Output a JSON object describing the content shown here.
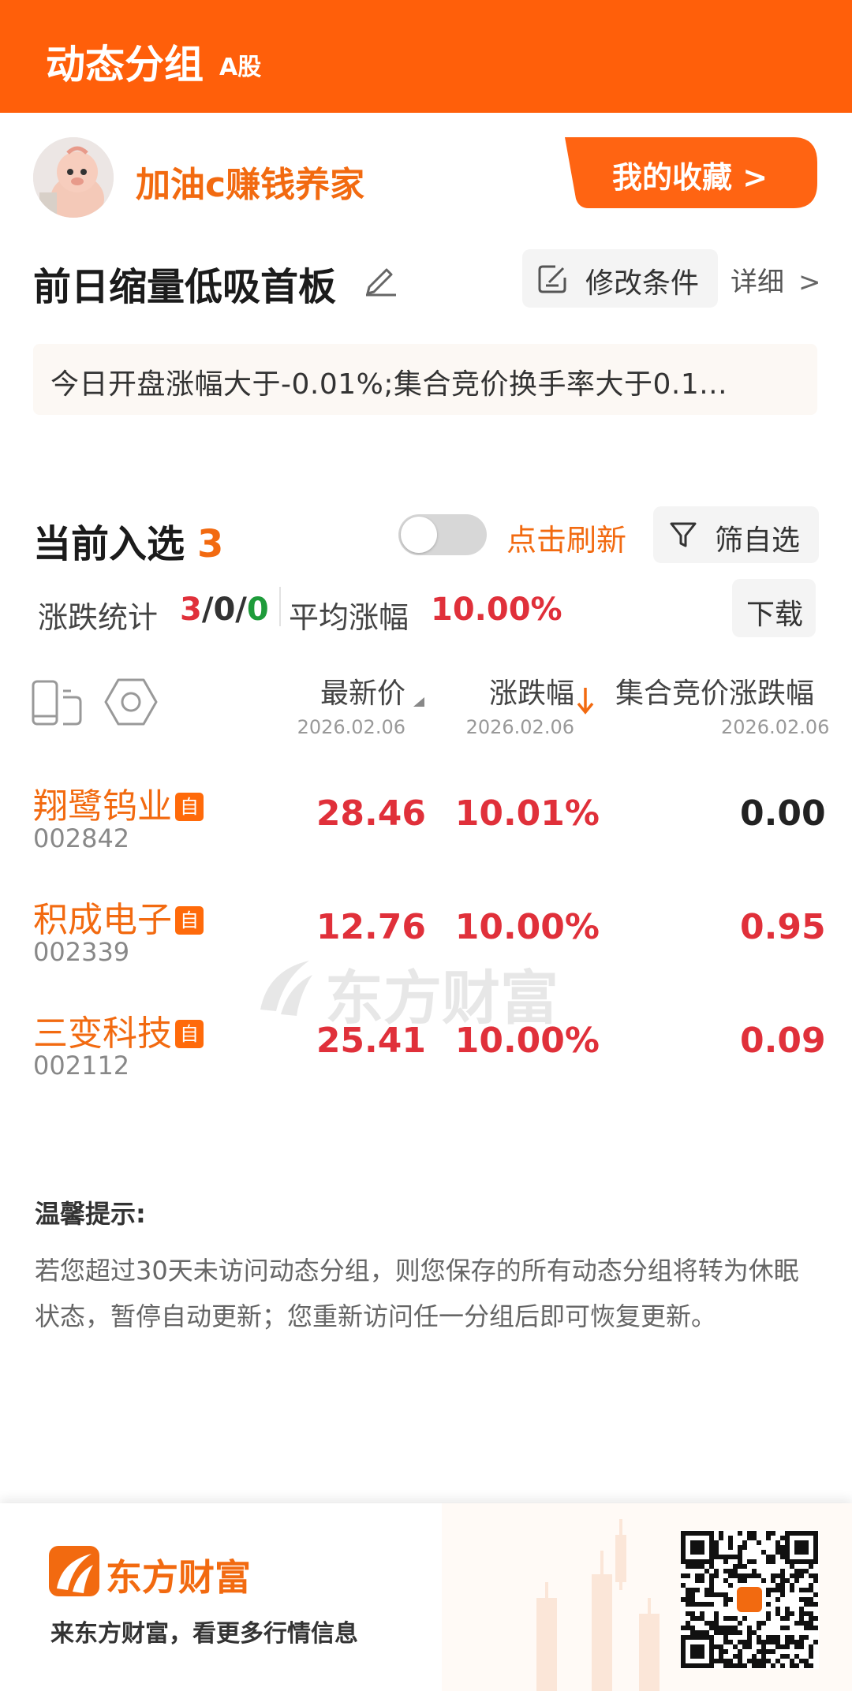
{
  "header": {
    "title": "动态分组",
    "badge": "A股"
  },
  "user": {
    "name": "加油c赚钱养家",
    "favorites_label": "我的收藏 >"
  },
  "strategy": {
    "title": "前日缩量低吸首板",
    "modify_label": "修改条件",
    "detail_label": "详细",
    "condition": "今日开盘涨幅大于-0.01%;集合竞价换手率大于0.1..."
  },
  "selection": {
    "label": "当前入选",
    "count": "3",
    "refresh_label": "点击刷新",
    "filter_label": "筛自选",
    "stats_label": "涨跌统计",
    "stats_up": "3",
    "stats_flat": "0",
    "stats_down": "0",
    "stats_sep": "/",
    "avg_label": "平均涨幅",
    "avg_value": "10.00%",
    "download_label": "下载",
    "auto_refresh_on": false
  },
  "table": {
    "columns": [
      {
        "name": "最新价",
        "date": "2026.02.06"
      },
      {
        "name": "涨跌幅",
        "date": "2026.02.06"
      },
      {
        "name": "集合竞价涨跌幅",
        "date": "2026.02.06"
      }
    ],
    "self_badge": "自",
    "rows": [
      {
        "name": "翔鹭钨业",
        "code": "002842",
        "price": "28.46",
        "change": "10.01%",
        "auction": "0.00%",
        "auction_color": "#222222"
      },
      {
        "name": "积成电子",
        "code": "002339",
        "price": "12.76",
        "change": "10.00%",
        "auction": "0.95%",
        "auction_color": "#e0303a"
      },
      {
        "name": "三变科技",
        "code": "002112",
        "price": "25.41",
        "change": "10.00%",
        "auction": "0.09%",
        "auction_color": "#e0303a"
      }
    ]
  },
  "watermark": "东方财富",
  "tips": {
    "title": "温馨提示:",
    "body": "若您超过30天未访问动态分组，则您保存的所有动态分组将转为休眠状态，暂停自动更新；您重新访问任一分组后即可恢复更新。"
  },
  "footer": {
    "brand": "东方财富",
    "slogan": "来东方财富，看更多行情信息"
  },
  "colors": {
    "brand": "#ff5f0a",
    "accent": "#f26a10",
    "up": "#e0303a",
    "down": "#1e9b3a"
  },
  "icons": [
    "edit-icon",
    "modify-icon",
    "chevron-right-icon",
    "filter-icon",
    "phone-layout-icon",
    "settings-hex-icon",
    "sort-triangle-icon",
    "sort-down-arrow-icon",
    "logo-icon",
    "qr-code"
  ]
}
